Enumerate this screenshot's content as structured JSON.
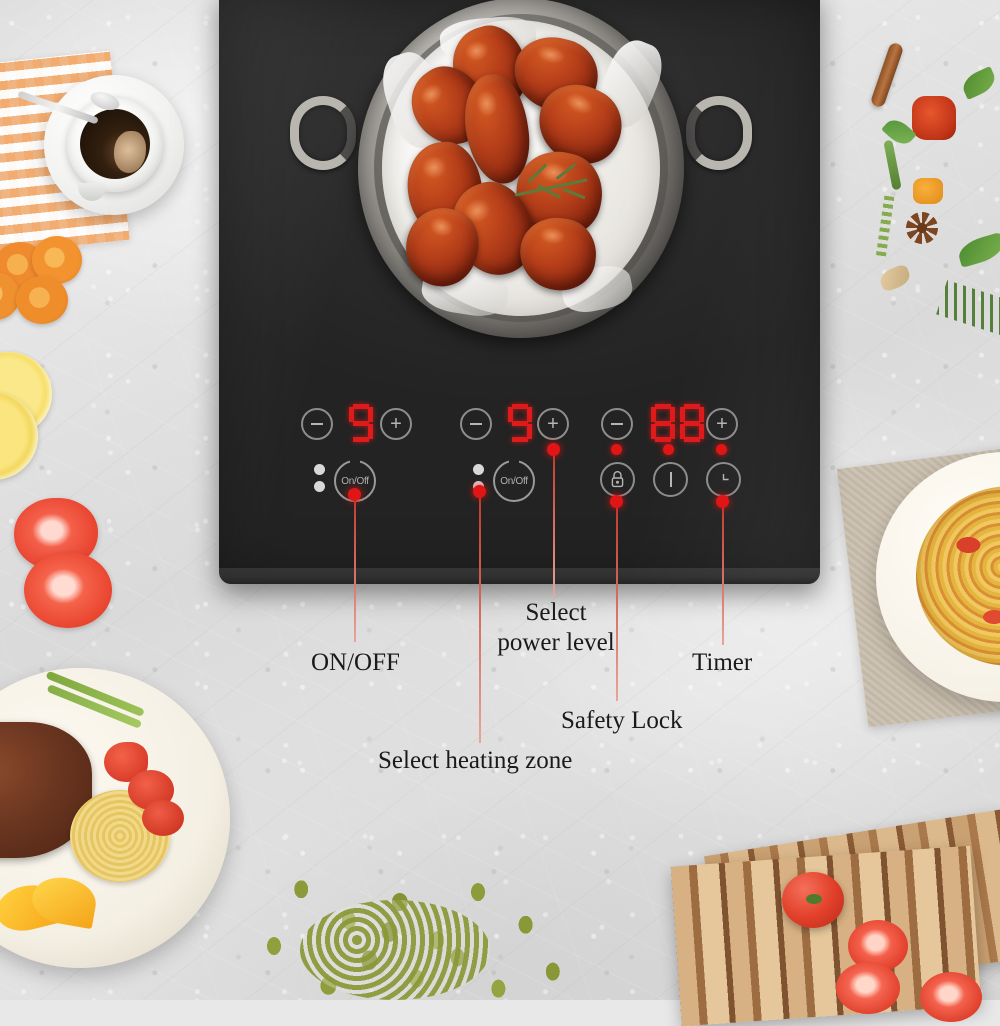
{
  "product": {
    "type": "induction-cooktop",
    "surface_color": "#2b2b2b",
    "accent_color": "#e11515",
    "cookware": "metal pan with parchment paper",
    "food": "glazed fried chicken wings with rosemary sprig"
  },
  "control_panel": {
    "zones": [
      {
        "id": "zone-left",
        "minus_label": "−",
        "plus_label": "+",
        "display_value": "9",
        "onoff_label": "On/Off",
        "zone_dots": 2
      },
      {
        "id": "zone-right",
        "minus_label": "−",
        "plus_label": "+",
        "display_value": "9",
        "onoff_label": "On/Off",
        "zone_dots": 2
      }
    ],
    "timer_group": {
      "id": "timer-group",
      "minus_label": "−",
      "plus_label": "+",
      "display_value": "88",
      "buttons": [
        {
          "id": "safety-lock",
          "icon": "padlock-icon"
        },
        {
          "id": "power",
          "icon": "power-bar-icon"
        },
        {
          "id": "timer",
          "icon": "clock-icon"
        }
      ],
      "indicator_count": 3
    }
  },
  "annotations": [
    {
      "id": "onoff",
      "label": "ON/OFF"
    },
    {
      "id": "heating-zone",
      "label": "Select heating zone"
    },
    {
      "id": "power-level",
      "label": "Select\npower level"
    },
    {
      "id": "safety-lock",
      "label": "Safety Lock"
    },
    {
      "id": "timer",
      "label": "Timer"
    }
  ],
  "background": {
    "surface": "light gray textured stone countertop",
    "props": [
      {
        "id": "coffee-cup",
        "name": "cup of black coffee on saucer with spoon"
      },
      {
        "id": "gingham-napkin",
        "name": "orange checkered napkin"
      },
      {
        "id": "carrot-slices",
        "name": "sliced carrots"
      },
      {
        "id": "lemon-slices",
        "name": "lemon slices"
      },
      {
        "id": "tomato-slices",
        "name": "tomato slices"
      },
      {
        "id": "steak-plate",
        "name": "plate with steak, asparagus, pasta and orange wedges"
      },
      {
        "id": "mung-beans",
        "name": "scattered mung beans"
      },
      {
        "id": "cutting-board",
        "name": "striped wooden cutting boards with tomatoes"
      },
      {
        "id": "pasta-plate",
        "name": "ornate plate of spaghetti on linen napkin"
      },
      {
        "id": "spices",
        "name": "cinnamon stick, star anise, dried tomato, basil, thyme, rosemary"
      }
    ]
  }
}
